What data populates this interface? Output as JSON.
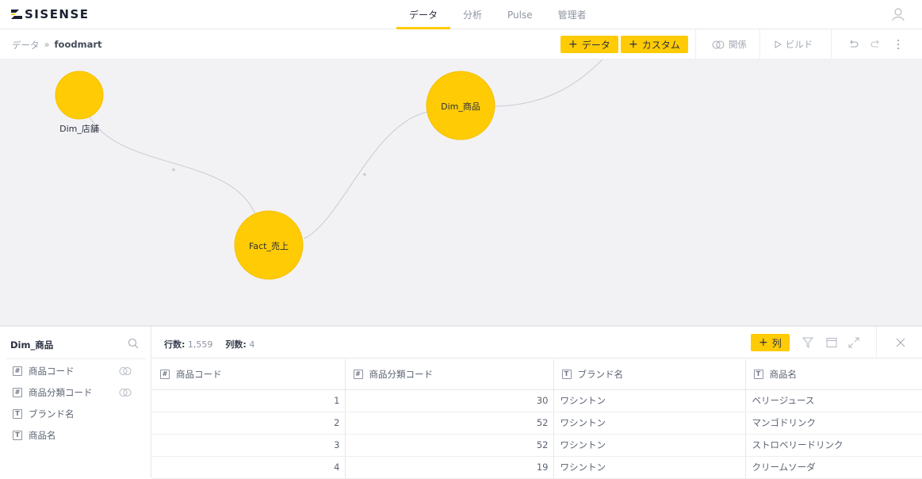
{
  "app": {
    "logo_text": "SISENSE"
  },
  "nav": {
    "tabs": [
      "データ",
      "分析",
      "Pulse",
      "管理者"
    ],
    "active": 0
  },
  "breadcrumb": {
    "root": "データ",
    "separator": "»",
    "current": "foodmart"
  },
  "toolbar": {
    "add_data_label": "データ",
    "add_custom_label": "カスタム",
    "relations_label": "関係",
    "build_label": "ビルド"
  },
  "model": {
    "nodes": [
      {
        "id": "dim-store",
        "label": "Dim_店舗"
      },
      {
        "id": "dim-product",
        "label": "Dim_商品"
      },
      {
        "id": "fact-sales",
        "label": "Fact_売上"
      }
    ]
  },
  "colors": {
    "accent": "#ffcb05",
    "node_fill": "#ffcb05",
    "node_stroke": "#f2bd00"
  },
  "panel": {
    "table_name": "Dim_商品",
    "fields": [
      {
        "type": "#",
        "name": "商品コード",
        "has_relation": true
      },
      {
        "type": "#",
        "name": "商品分類コード",
        "has_relation": true
      },
      {
        "type": "T",
        "name": "ブランド名",
        "has_relation": false
      },
      {
        "type": "T",
        "name": "商品名",
        "has_relation": false
      }
    ],
    "rows_label": "行数:",
    "rows_value": "1,559",
    "cols_label": "列数:",
    "cols_value": "4",
    "add_column_label": "列"
  },
  "grid": {
    "columns": [
      {
        "type": "#",
        "name": "商品コード"
      },
      {
        "type": "#",
        "name": "商品分類コード"
      },
      {
        "type": "T",
        "name": "ブランド名"
      },
      {
        "type": "T",
        "name": "商品名"
      }
    ],
    "rows": [
      [
        "1",
        "30",
        "ワシントン",
        "ベリージュース"
      ],
      [
        "2",
        "52",
        "ワシントン",
        "マンゴドリンク"
      ],
      [
        "3",
        "52",
        "ワシントン",
        "ストロベリードリンク"
      ],
      [
        "4",
        "19",
        "ワシントン",
        "クリームソーダ"
      ]
    ]
  }
}
